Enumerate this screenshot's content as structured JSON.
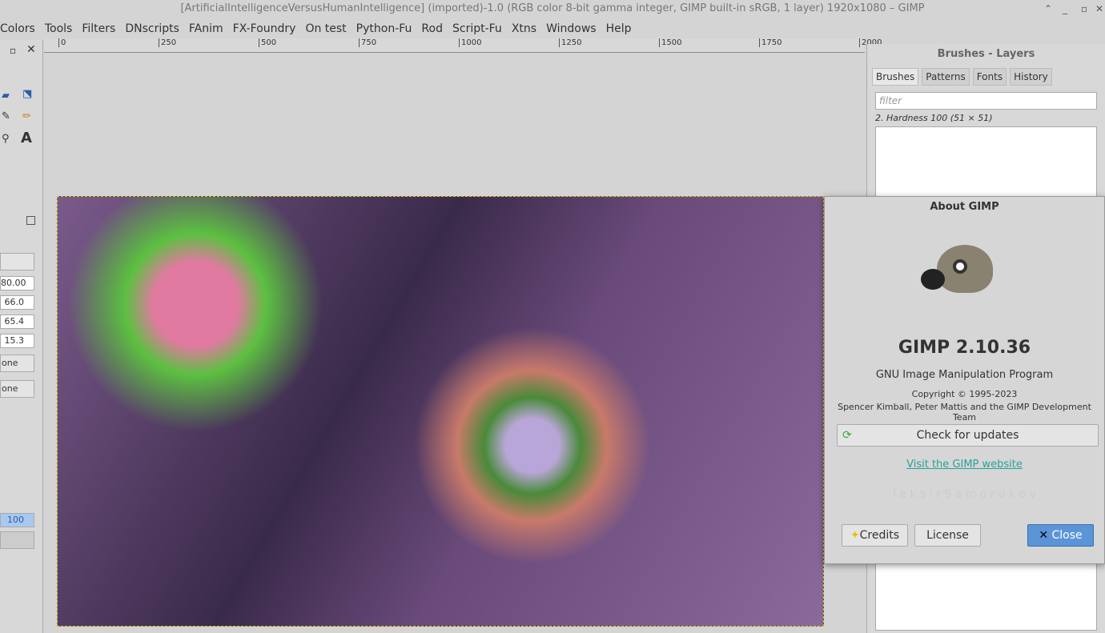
{
  "window": {
    "title": "[ArtificialIntelligenceVersusHumanIntelligence] (imported)-1.0 (RGB color 8-bit gamma integer, GIMP built-in sRGB, 1 layer) 1920x1080 – GIMP"
  },
  "menu": [
    "Colors",
    "Tools",
    "Filters",
    "DNscripts",
    "FAnim",
    "FX-Foundry",
    "On test",
    "Python-Fu",
    "Rod",
    "Script-Fu",
    "Xtns",
    "Windows",
    "Help"
  ],
  "ruler": [
    "0",
    "250",
    "500",
    "750",
    "1000",
    "1250",
    "1500",
    "1750",
    "2000"
  ],
  "tool_options": {
    "values": [
      "80.00",
      "66.0",
      "65.4",
      "15.3"
    ],
    "combos": [
      "one",
      "one"
    ],
    "opacity": "100"
  },
  "dock": {
    "title": "Brushes - Layers",
    "tabs": [
      "Brushes",
      "Patterns",
      "Fonts",
      "History"
    ],
    "filter_placeholder": "filter",
    "brush_name": "2. Hardness 100 (51 × 51)"
  },
  "about": {
    "title": "About GIMP",
    "version": "GIMP 2.10.36",
    "subtitle": "GNU Image Manipulation Program",
    "copyright": "Copyright © 1995-2023",
    "authors": "Spencer Kimball, Peter Mattis and the GIMP Development Team",
    "check_updates": "Check for updates",
    "website_link": "Visit the GIMP website",
    "animated_credit": "l e k s i r   S a m o r u k o v",
    "credits": "Credits",
    "license": "License",
    "close": "Close"
  }
}
